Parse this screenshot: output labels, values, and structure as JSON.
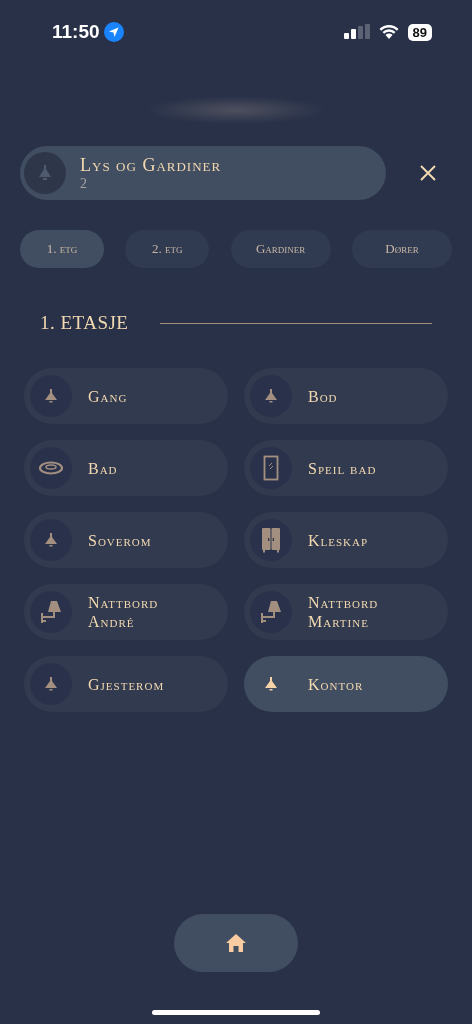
{
  "status_bar": {
    "time": "11:50",
    "battery": "89"
  },
  "header": {
    "title": "Lys og Gardiner",
    "subtitle": "2"
  },
  "tabs": [
    {
      "label": "1. etg",
      "selected": true
    },
    {
      "label": "2. etg",
      "selected": false
    },
    {
      "label": "Gardiner",
      "selected": false
    },
    {
      "label": "Dører",
      "selected": false
    }
  ],
  "section": {
    "title": "1. ETASJE"
  },
  "rooms": [
    {
      "name": "Gang",
      "kind": "pendant",
      "selected": false
    },
    {
      "name": "Bod",
      "kind": "pendant",
      "selected": false
    },
    {
      "name": "Bad",
      "kind": "ring",
      "selected": false
    },
    {
      "name": "Speil bad",
      "kind": "mirror",
      "selected": false
    },
    {
      "name": "Soverom",
      "kind": "pendant",
      "selected": false
    },
    {
      "name": "Kleskap",
      "kind": "wardrobe",
      "selected": false
    },
    {
      "name": "Nattbord André",
      "kind": "wall-lamp",
      "selected": false
    },
    {
      "name": "Nattbord Martine",
      "kind": "wall-lamp",
      "selected": false
    },
    {
      "name": "Gjesterom",
      "kind": "pendant",
      "selected": false
    },
    {
      "name": "Kontor",
      "kind": "pendant",
      "selected": true
    }
  ]
}
